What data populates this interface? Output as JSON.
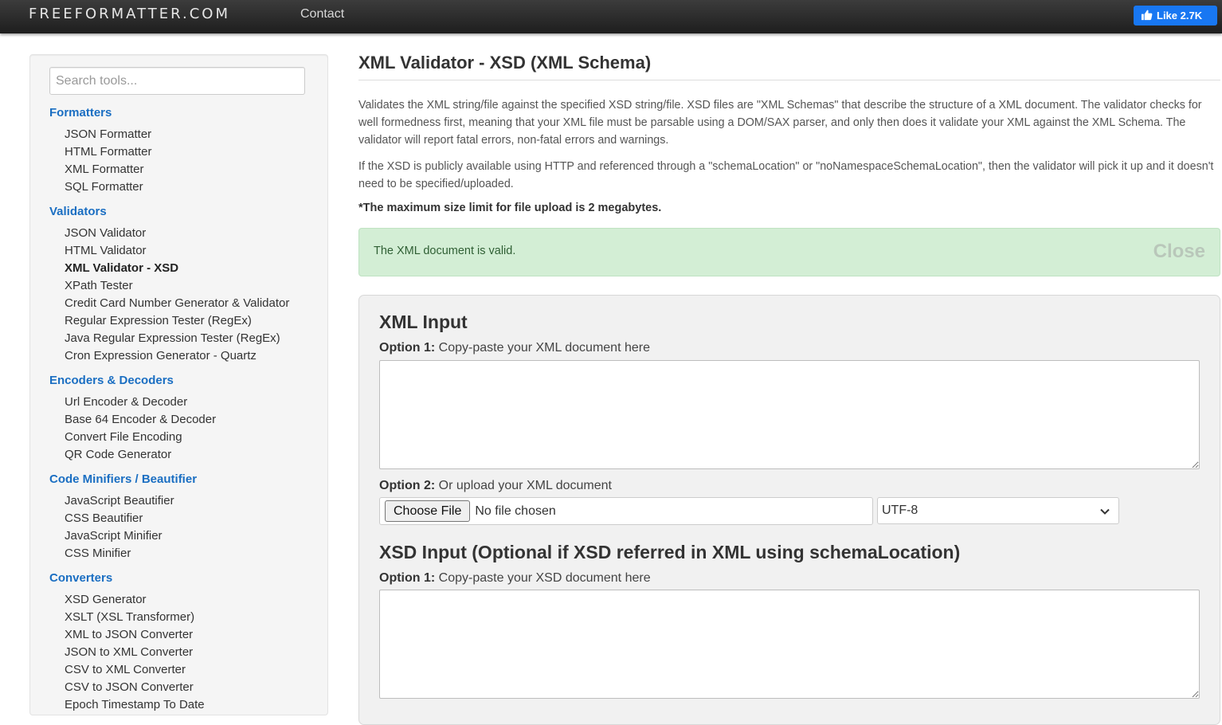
{
  "header": {
    "brand": "FREEFORMATTER.COM",
    "nav_contact": "Contact",
    "like_label": "Like 2.7K",
    "like_color": "#1877f2"
  },
  "sidebar": {
    "search_placeholder": "Search tools...",
    "categories": [
      {
        "title": "Formatters",
        "items": [
          "JSON Formatter",
          "HTML Formatter",
          "XML Formatter",
          "SQL Formatter"
        ]
      },
      {
        "title": "Validators",
        "items": [
          "JSON Validator",
          "HTML Validator",
          "XML Validator - XSD",
          "XPath Tester",
          "Credit Card Number Generator & Validator",
          "Regular Expression Tester (RegEx)",
          "Java Regular Expression Tester (RegEx)",
          "Cron Expression Generator - Quartz"
        ]
      },
      {
        "title": "Encoders & Decoders",
        "items": [
          "Url Encoder & Decoder",
          "Base 64 Encoder & Decoder",
          "Convert File Encoding",
          "QR Code Generator"
        ]
      },
      {
        "title": "Code Minifiers / Beautifier",
        "items": [
          "JavaScript Beautifier",
          "CSS Beautifier",
          "JavaScript Minifier",
          "CSS Minifier"
        ]
      },
      {
        "title": "Converters",
        "items": [
          "XSD Generator",
          "XSLT (XSL Transformer)",
          "XML to JSON Converter",
          "JSON to XML Converter",
          "CSV to XML Converter",
          "CSV to JSON Converter",
          "Epoch Timestamp To Date"
        ]
      }
    ],
    "active_item": "XML Validator - XSD",
    "category_color": "#1a6ec2"
  },
  "main": {
    "title": "XML Validator - XSD (XML Schema)",
    "description_1": "Validates the XML string/file against the specified XSD string/file. XSD files are \"XML Schemas\" that describe the structure of a XML document. The validator checks for well formedness first, meaning that your XML file must be parsable using a DOM/SAX parser, and only then does it validate your XML against the XML Schema. The validator will report fatal errors, non-fatal errors and warnings.",
    "description_2": "If the XSD is publicly available using HTTP and referenced through a \"schemaLocation\" or \"noNamespaceSchemaLocation\", then the validator will pick it up and it doesn't need to be specified/uploaded.",
    "size_limit": "*The maximum size limit for file upload is 2 megabytes.",
    "alert": {
      "message": "The XML document is valid.",
      "close_label": "Close",
      "color": "#d3eed5"
    },
    "xml_input": {
      "heading": "XML Input",
      "option1_label": "Option 1:",
      "option1_text": "Copy-paste your XML document here",
      "option1_value": "",
      "option2_label": "Option 2:",
      "option2_text": "Or upload your XML document",
      "choose_file_label": "Choose File",
      "file_status": "No file chosen",
      "encoding": "UTF-8"
    },
    "xsd_input": {
      "heading": "XSD Input (Optional if XSD referred in XML using schemaLocation)",
      "option1_label": "Option 1:",
      "option1_text": "Copy-paste your XSD document here",
      "option1_value": ""
    }
  }
}
